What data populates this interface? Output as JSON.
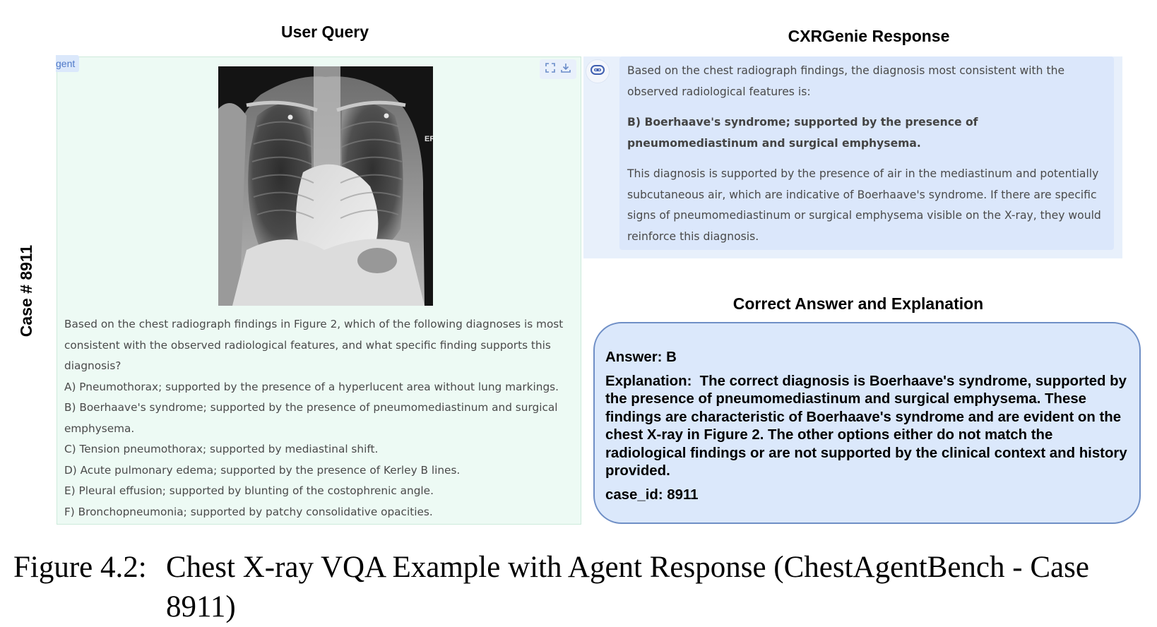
{
  "headings": {
    "user_query": "User Query",
    "response": "CXRGenie Response",
    "correct": "Correct Answer and Explanation"
  },
  "case_label": "Case # 8911",
  "query_panel": {
    "agent_tag": "gent",
    "toolbar_icons": [
      "fullscreen-icon",
      "download-icon"
    ],
    "xray_overlay_text": "ER",
    "question": "Based on the chest radiograph findings in Figure 2, which of the following diagnoses is most consistent with the observed radiological features, and what specific finding supports this diagnosis?",
    "options": [
      "A) Pneumothorax; supported by the presence of a hyperlucent area without lung markings.",
      "B) Boerhaave's syndrome; supported by the presence of pneumomediastinum and surgical emphysema.",
      "C) Tension pneumothorax; supported by mediastinal shift.",
      "D) Acute pulmonary edema; supported by the presence of Kerley B lines.",
      "E) Pleural effusion; supported by blunting of the costophrenic angle.",
      "F) Bronchopneumonia; supported by patchy consolidative opacities."
    ]
  },
  "response_panel": {
    "avatar_icon": "bot-icon",
    "intro": "Based on the chest radiograph findings, the diagnosis most consistent with the observed radiological features is:",
    "answer": "B) Boerhaave's syndrome; supported by the presence of pneumomediastinum and surgical emphysema.",
    "explanation": "This diagnosis is supported by the presence of air in the mediastinum and potentially subcutaneous air, which are indicative of Boerhaave's syndrome. If there are specific signs of pneumomediastinum or surgical emphysema visible on the X-ray, they would reinforce this diagnosis."
  },
  "correct_panel": {
    "answer": "Answer: B",
    "explanation": "Explanation:  The correct diagnosis is Boerhaave's syndrome, supported by the presence of pneumomediastinum and surgical emphysema. These findings are characteristic of Boerhaave's syndrome and are evident on the chest X-ray in Figure 2. The other options either do not match the radiological findings or are not supported by the clinical context and history provided.",
    "case_id": "case_id: 8911"
  },
  "caption": {
    "number": "Figure 4.2:",
    "text": "Chest X-ray VQA Example with Agent Response (ChestAgentBench - Case 8911)"
  },
  "colors": {
    "query_bg": "#edfaf4",
    "response_bg": "#dbe7fb",
    "answer_border": "#6f8fc6",
    "accent": "#4f79c8"
  }
}
